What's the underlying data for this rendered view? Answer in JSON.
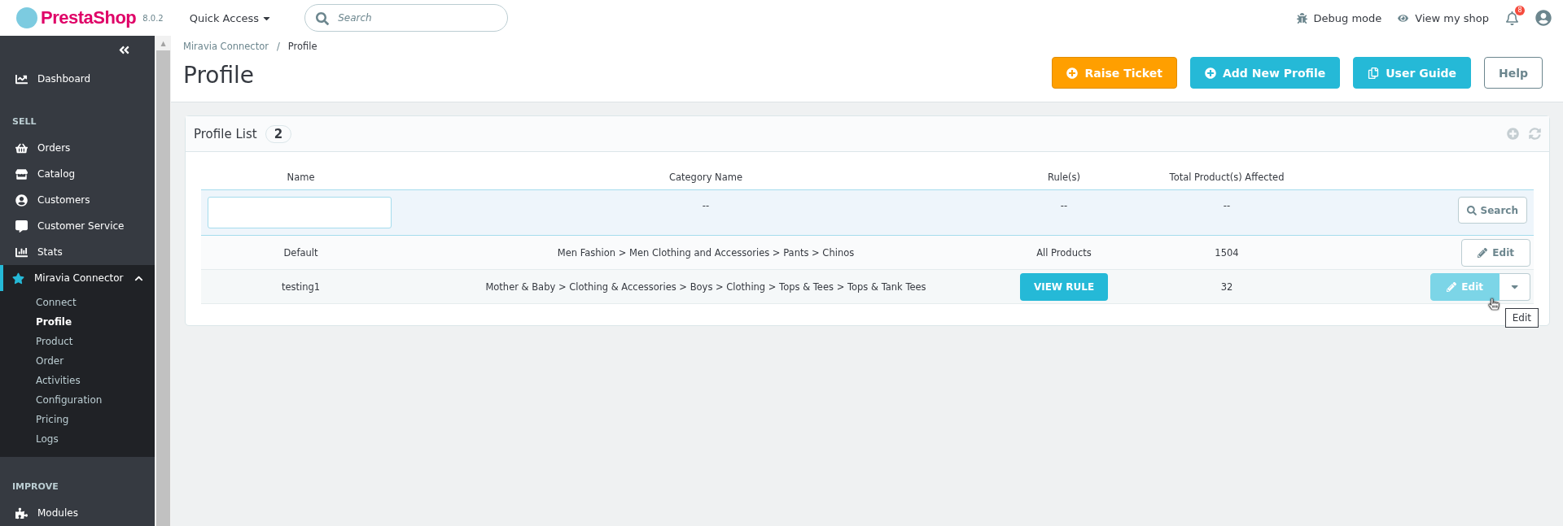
{
  "header": {
    "logo": "PrestaShop",
    "version": "8.0.2",
    "quick_access": "Quick Access",
    "search": {
      "placeholder": "Search"
    },
    "debug": "Debug mode",
    "view_shop": "View my shop",
    "notifications": "8"
  },
  "sidebar": {
    "scroll_arrow": "▲",
    "sections": [
      {
        "items": [
          {
            "label": "Dashboard",
            "selected": false
          }
        ]
      },
      {
        "title": "SELL",
        "items": [
          {
            "label": "Orders",
            "selected": false
          },
          {
            "label": "Catalog",
            "selected": false
          },
          {
            "label": "Customers",
            "selected": false
          },
          {
            "label": "Customer Service",
            "selected": false
          },
          {
            "label": "Stats",
            "selected": false
          },
          {
            "label": "Miravia Connector",
            "expanded": true,
            "selected": true,
            "children": [
              {
                "label": "Connect",
                "selected": false
              },
              {
                "label": "Profile",
                "selected": true
              },
              {
                "label": "Product",
                "selected": false
              },
              {
                "label": "Order",
                "selected": false
              },
              {
                "label": "Activities",
                "selected": false
              },
              {
                "label": "Configuration",
                "selected": false
              },
              {
                "label": "Pricing",
                "selected": false
              },
              {
                "label": "Logs",
                "selected": false
              }
            ]
          }
        ]
      },
      {
        "title": "IMPROVE",
        "items": [
          {
            "label": "Modules",
            "selected": false
          }
        ]
      }
    ]
  },
  "breadcrumb": {
    "separator": "/",
    "items": [
      "Miravia Connector",
      "Profile"
    ]
  },
  "title": "Profile",
  "toolbar": [
    {
      "label": "Raise Ticket",
      "kind": "warning"
    },
    {
      "label": "Add New Profile",
      "kind": "primary"
    },
    {
      "label": "User Guide",
      "kind": "primary"
    },
    {
      "label": "Help",
      "kind": "outline"
    }
  ],
  "panel": {
    "title": "Profile List",
    "count": "2",
    "columns": [
      "Name",
      "Category Name",
      "Rule(s)",
      "Total Product(s) Affected"
    ],
    "filter": {
      "category": "--",
      "rules": "--",
      "total": "--",
      "button": "Search"
    },
    "rows": [
      {
        "name": "Default",
        "category": "Men Fashion > Men Clothing and Accessories > Pants > Chinos",
        "rule": {
          "kind": "text",
          "label": "All Products"
        },
        "total": "1504",
        "edit": {
          "label": "Edit",
          "hovered": false,
          "dropdown": false
        }
      },
      {
        "name": "testing1",
        "category": "Mother & Baby > Clothing & Accessories > Boys > Clothing > Tops & Tees > Tops & Tank Tees",
        "rule": {
          "kind": "button",
          "label": "VIEW RULE"
        },
        "total": "32",
        "edit": {
          "label": "Edit",
          "hovered": true,
          "dropdown": true
        }
      }
    ]
  },
  "tooltip": "Edit"
}
